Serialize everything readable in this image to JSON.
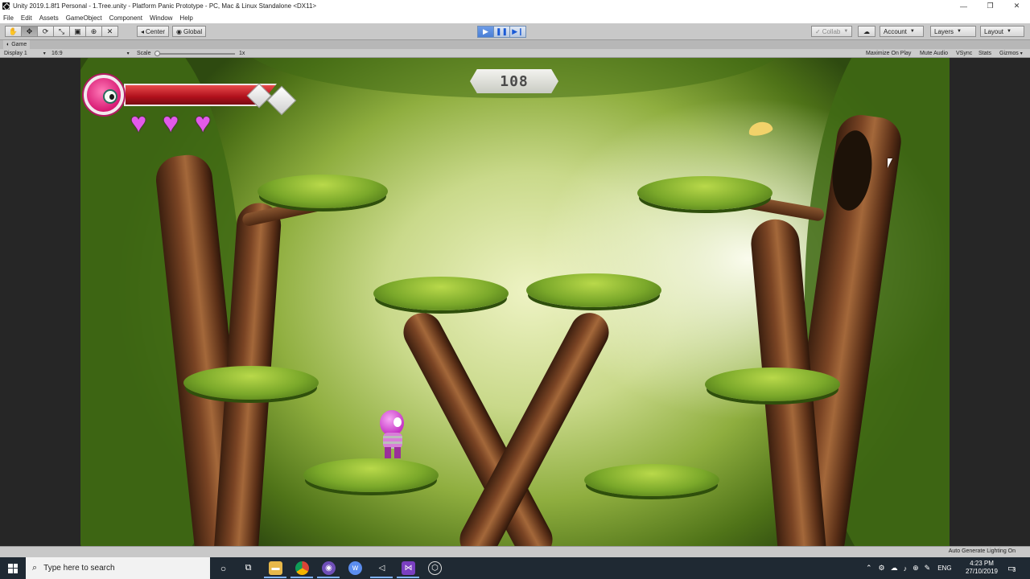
{
  "window": {
    "title": "Unity 2019.1.8f1 Personal - 1.Tree.unity - Platform Panic Prototype - PC, Mac & Linux Standalone <DX11>",
    "minimize": "—",
    "maximize": "❐",
    "close": "✕"
  },
  "menu": {
    "items": [
      "File",
      "Edit",
      "Assets",
      "GameObject",
      "Component",
      "Window",
      "Help"
    ]
  },
  "toolbar": {
    "tools": [
      "hand",
      "move",
      "rotate",
      "scale",
      "rect",
      "transform",
      "custom"
    ],
    "pivot_label": "Center",
    "space_label": "Global",
    "collab_label": "Collab",
    "account_label": "Account",
    "layers_label": "Layers",
    "layout_label": "Layout",
    "play_state": "playing"
  },
  "game_panel": {
    "tab_label": "Game",
    "display_label": "Display 1",
    "aspect_label": "16:9",
    "scale_label": "Scale",
    "scale_value": "1x",
    "maximize_on_play": "Maximize On Play",
    "mute_audio": "Mute Audio",
    "vsync": "VSync",
    "stats": "Stats",
    "gizmos": "Gizmos"
  },
  "hud": {
    "timer": "108",
    "hearts": [
      "♥",
      "♥",
      "♥"
    ],
    "health_fraction": 1.0,
    "colors": {
      "health": "#c1121f",
      "heart": "#e25aea",
      "portrait": "#d81b74"
    }
  },
  "status": {
    "text": "Auto Generate Lighting On"
  },
  "taskbar": {
    "search_placeholder": "Type here to search",
    "language": "ENG",
    "time": "4:23 PM",
    "date": "27/10/2019",
    "notification_count": "3",
    "apps": [
      "task-view",
      "file-explorer",
      "chrome",
      "obs",
      "wunderlist",
      "unity",
      "visual-studio",
      "unity-hub"
    ]
  }
}
